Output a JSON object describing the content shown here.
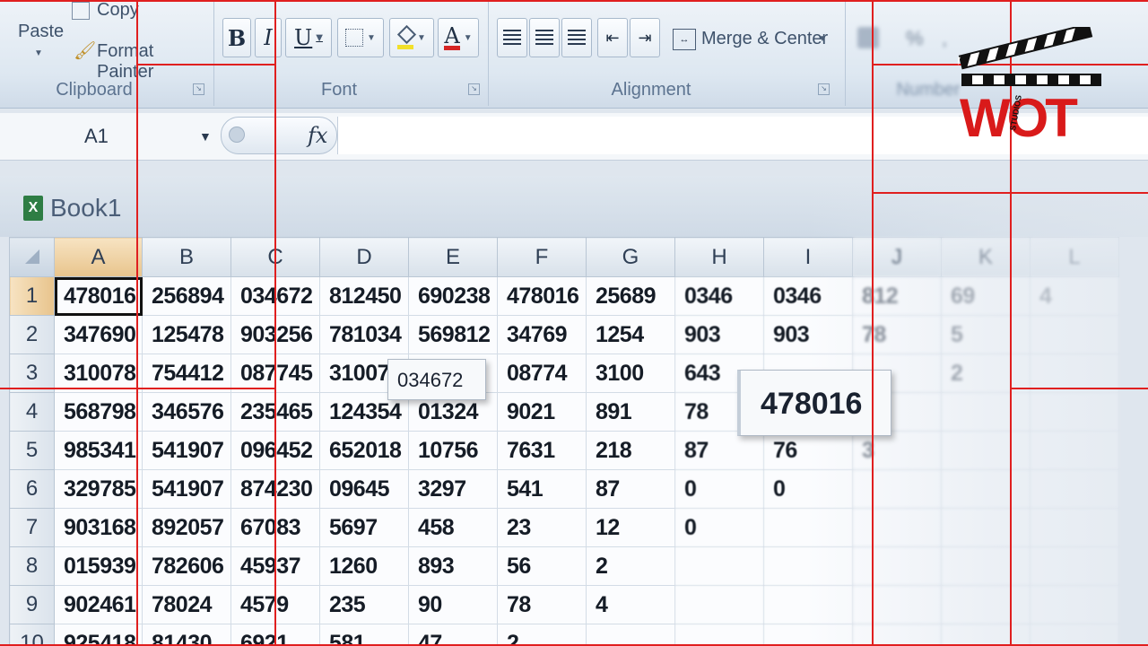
{
  "ribbon": {
    "clipboard": {
      "paste_label": "Paste",
      "copy_label": "Copy",
      "format_painter_label": "Format Painter",
      "group_label": "Clipboard"
    },
    "font": {
      "bold": "B",
      "italic": "I",
      "underline": "U",
      "font_color": "A",
      "group_label": "Font"
    },
    "alignment": {
      "merge_label": "Merge & Center",
      "group_label": "Alignment"
    },
    "number": {
      "group_label": "Number"
    }
  },
  "formula_bar": {
    "name_box": "A1",
    "fx": "fx",
    "value": ""
  },
  "workbook": {
    "title": "Book1",
    "icon_letter": "X"
  },
  "grid": {
    "columns": [
      "A",
      "B",
      "C",
      "D",
      "E",
      "F",
      "G",
      "H",
      "I",
      "J",
      "K",
      "L"
    ],
    "active_column": "A",
    "active_row": "1",
    "rows": [
      {
        "n": "1",
        "cells": [
          "478016",
          "256894",
          "034672",
          "812450",
          "690238",
          "478016",
          "25689",
          "0346",
          "0346",
          "812",
          "69",
          "4"
        ]
      },
      {
        "n": "2",
        "cells": [
          "347690",
          "125478",
          "903256",
          "781034",
          "569812",
          "34769",
          "1254",
          "903",
          "903",
          "78",
          "5",
          ""
        ]
      },
      {
        "n": "3",
        "cells": [
          "310078",
          "754412",
          "087745",
          "310078",
          "",
          "08774",
          "3100",
          "643",
          "",
          "",
          "2",
          ""
        ]
      },
      {
        "n": "4",
        "cells": [
          "568798",
          "346576",
          "235465",
          "124354",
          "01324",
          "9021",
          "891",
          "78",
          "",
          "",
          "",
          ""
        ]
      },
      {
        "n": "5",
        "cells": [
          "985341",
          "541907",
          "096452",
          "652018",
          "10756",
          "7631",
          "218",
          "87",
          "76",
          "3",
          "",
          ""
        ]
      },
      {
        "n": "6",
        "cells": [
          "329785",
          "541907",
          "874230",
          "09645",
          "3297",
          "541",
          "87",
          "0",
          "0",
          "",
          "",
          ""
        ]
      },
      {
        "n": "7",
        "cells": [
          "903168",
          "892057",
          "67083",
          "5697",
          "458",
          "23",
          "12",
          "0",
          "",
          "",
          "",
          ""
        ]
      },
      {
        "n": "8",
        "cells": [
          "015939",
          "782606",
          "45937",
          "1260",
          "893",
          "56",
          "2",
          "",
          "",
          "",
          "",
          ""
        ]
      },
      {
        "n": "9",
        "cells": [
          "902461",
          "78024",
          "4579",
          "235",
          "90",
          "78",
          "4",
          "",
          "",
          "",
          "",
          ""
        ]
      },
      {
        "n": "10",
        "cells": [
          "925418",
          "81430",
          "6921",
          "581",
          "47",
          "2",
          "",
          "",
          "",
          "",
          "",
          ""
        ]
      }
    ]
  },
  "popups": {
    "small": "034672",
    "large": "478016"
  },
  "logo": {
    "text": "WOT",
    "subtext": "STUDIOS"
  },
  "colors": {
    "guide_lines": "#e01f1f",
    "active_header": "#e8c48c",
    "logo_red": "#d91a1a"
  }
}
